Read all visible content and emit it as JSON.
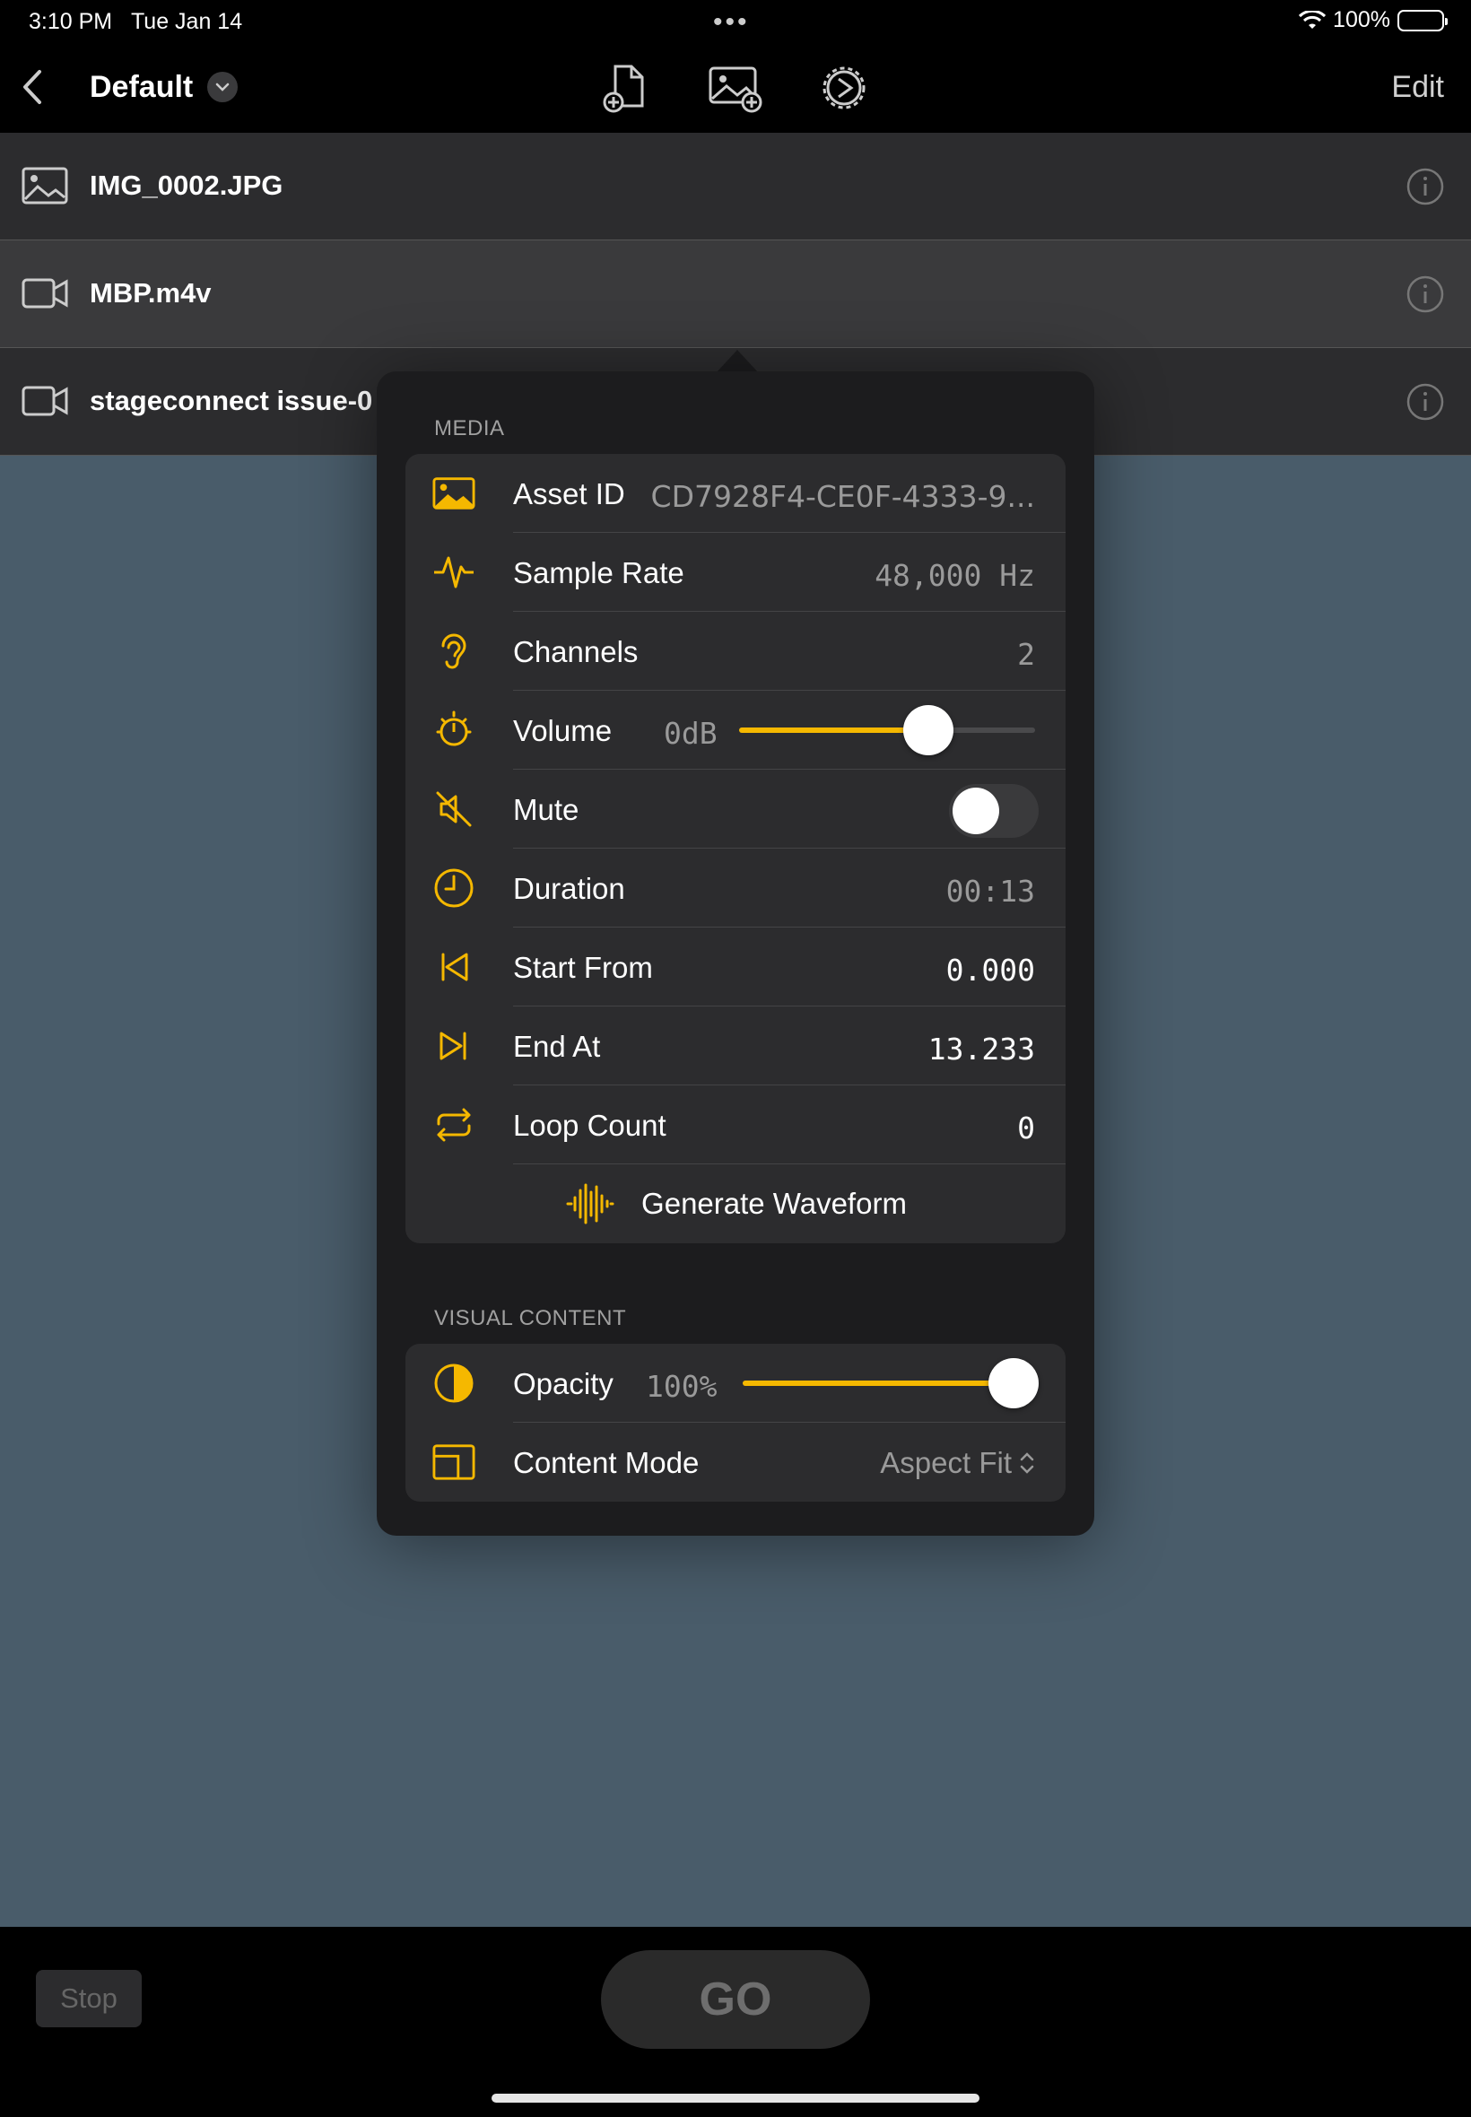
{
  "status_bar": {
    "time": "3:10 PM",
    "date": "Tue Jan 14",
    "battery": "100%"
  },
  "nav": {
    "title": "Default",
    "edit_label": "Edit"
  },
  "files": [
    {
      "name": "IMG_0002.JPG",
      "type": "image"
    },
    {
      "name": "MBP.m4v",
      "type": "video"
    },
    {
      "name": "stageconnect issue-0",
      "type": "video"
    }
  ],
  "popover": {
    "media_section": "MEDIA",
    "asset_id": {
      "label": "Asset ID",
      "value": "CD7928F4-CE0F-4333-9..."
    },
    "sample_rate": {
      "label": "Sample Rate",
      "value": "48,000 Hz"
    },
    "channels": {
      "label": "Channels",
      "value": "2"
    },
    "volume": {
      "label": "Volume",
      "value": "0dB",
      "level": 0.64
    },
    "mute": {
      "label": "Mute",
      "on": false
    },
    "duration": {
      "label": "Duration",
      "value": "00:13"
    },
    "start_from": {
      "label": "Start From",
      "value": "0.000"
    },
    "end_at": {
      "label": "End At",
      "value": "13.233"
    },
    "loop_count": {
      "label": "Loop Count",
      "value": "0"
    },
    "generate_waveform": "Generate Waveform",
    "visual_section": "VISUAL CONTENT",
    "opacity": {
      "label": "Opacity",
      "value": "100%",
      "level": 1.0
    },
    "content_mode": {
      "label": "Content Mode",
      "value": "Aspect Fit"
    }
  },
  "bottom": {
    "stop_label": "Stop",
    "go_label": "GO"
  },
  "colors": {
    "accent": "#f5b800",
    "stage": "#495c6a",
    "list_bg": "#2c2c2e"
  },
  "icons": [
    "chevron-left-icon",
    "chevron-down-icon",
    "document-add-icon",
    "image-add-icon",
    "settings-gear-icon",
    "photo-icon",
    "video-icon",
    "info-icon",
    "waveform-icon",
    "ear-icon",
    "timer-icon",
    "mute-icon",
    "clock-icon",
    "start-icon",
    "end-icon",
    "loop-icon",
    "opacity-icon",
    "content-mode-icon"
  ]
}
